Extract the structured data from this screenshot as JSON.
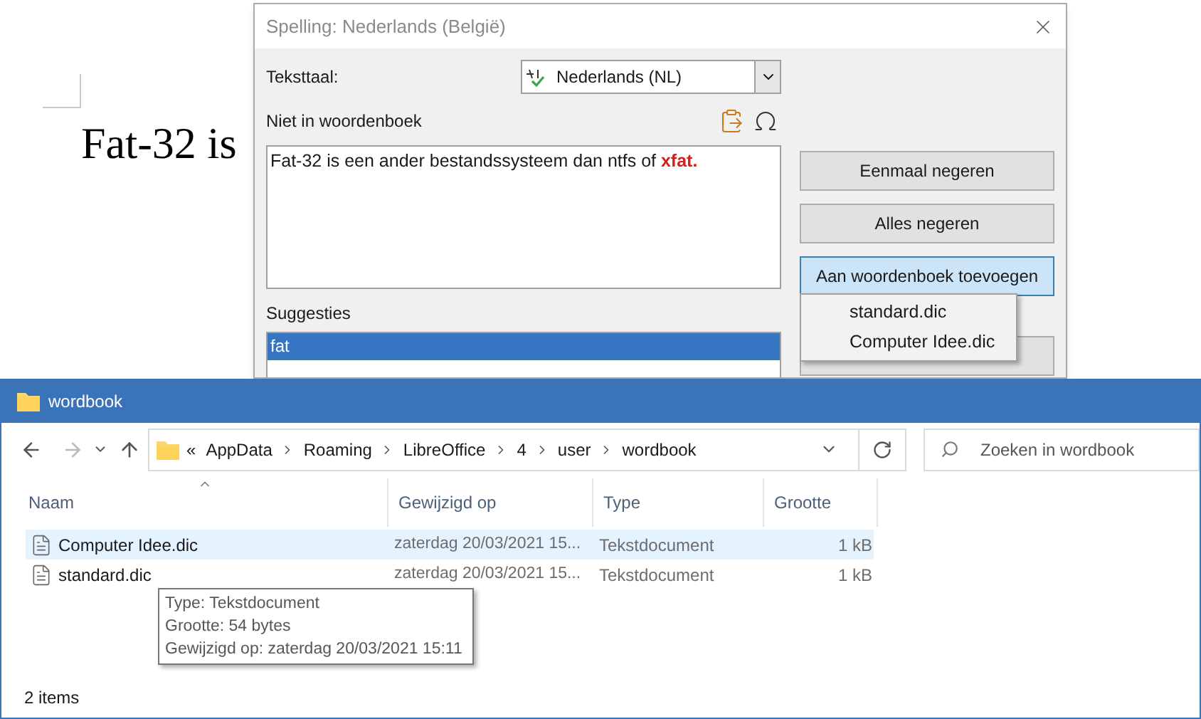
{
  "document": {
    "text": "Fat-32 is"
  },
  "spelling_dialog": {
    "title": "Spelling: Nederlands (België)",
    "language_label": "Teksttaal:",
    "language_value": "Nederlands (NL)",
    "not_in_dictionary_label": "Niet in woordenboek",
    "sentence": "Fat-32 is een ander bestandssysteem dan ntfs of ",
    "error_word": "xfat.",
    "buttons": [
      {
        "label": "Eenmaal negeren",
        "selected": false
      },
      {
        "label": "Alles negeren",
        "selected": false
      },
      {
        "label": "Aan woordenboek toevoegen",
        "selected": true
      }
    ],
    "dictionary_menu": [
      "standard.dic",
      "Computer Idee.dic"
    ],
    "suggestions_label": "Suggesties",
    "suggestions": [
      {
        "text": "fat",
        "selected": true
      }
    ]
  },
  "explorer": {
    "title": "wordbook",
    "path_prefix": "«",
    "path": [
      "AppData",
      "Roaming",
      "LibreOffice",
      "4",
      "user",
      "wordbook"
    ],
    "search": {
      "placeholder": "Zoeken in wordbook"
    },
    "columns": [
      "Naam",
      "Gewijzigd op",
      "Type",
      "Grootte"
    ],
    "rows": [
      {
        "name": "Computer Idee.dic",
        "modified": "zaterdag 20/03/2021 15...",
        "type": "Tekstdocument",
        "size": "1 kB",
        "selected": true
      },
      {
        "name": "standard.dic",
        "modified": "zaterdag 20/03/2021 15...",
        "type": "Tekstdocument",
        "size": "1 kB",
        "selected": false
      }
    ],
    "tooltip": [
      "Type: Tekstdocument",
      "Grootte: 54 bytes",
      "Gewijzigd op: zaterdag 20/03/2021 15:11"
    ],
    "status": "2 items"
  }
}
